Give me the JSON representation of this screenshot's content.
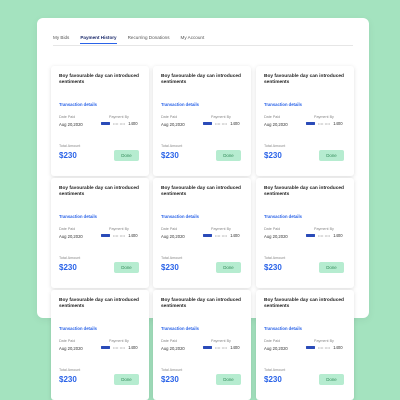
{
  "tabs": [
    {
      "label": "My Bids",
      "active": false
    },
    {
      "label": "Payment History",
      "active": true
    },
    {
      "label": "Recurring Donations",
      "active": false
    },
    {
      "label": "My Account",
      "active": false
    }
  ],
  "card_template": {
    "title": "Boy favourable day can introduced sentiments",
    "link": "Transaction details",
    "date_label": "Date Paid",
    "date": "Aug 20,2020",
    "payment_label": "Payment By",
    "card_dots": "•••• ••••",
    "card_last4": "1400",
    "total_label": "Total Amount",
    "amount": "$230",
    "status": "Done"
  },
  "cards": [
    {
      "row": 1,
      "col": 1
    },
    {
      "row": 1,
      "col": 2
    },
    {
      "row": 1,
      "col": 3
    },
    {
      "row": 2,
      "col": 1
    },
    {
      "row": 2,
      "col": 2
    },
    {
      "row": 2,
      "col": 3
    },
    {
      "row": 3,
      "col": 1
    },
    {
      "row": 3,
      "col": 2
    },
    {
      "row": 3,
      "col": 3
    }
  ],
  "colors": {
    "background": "#a4e3bf",
    "accent": "#2a63e8",
    "done_bg": "#b6ecd0",
    "done_text": "#2f8a57"
  },
  "icons": {
    "payment_card": "card-icon"
  }
}
